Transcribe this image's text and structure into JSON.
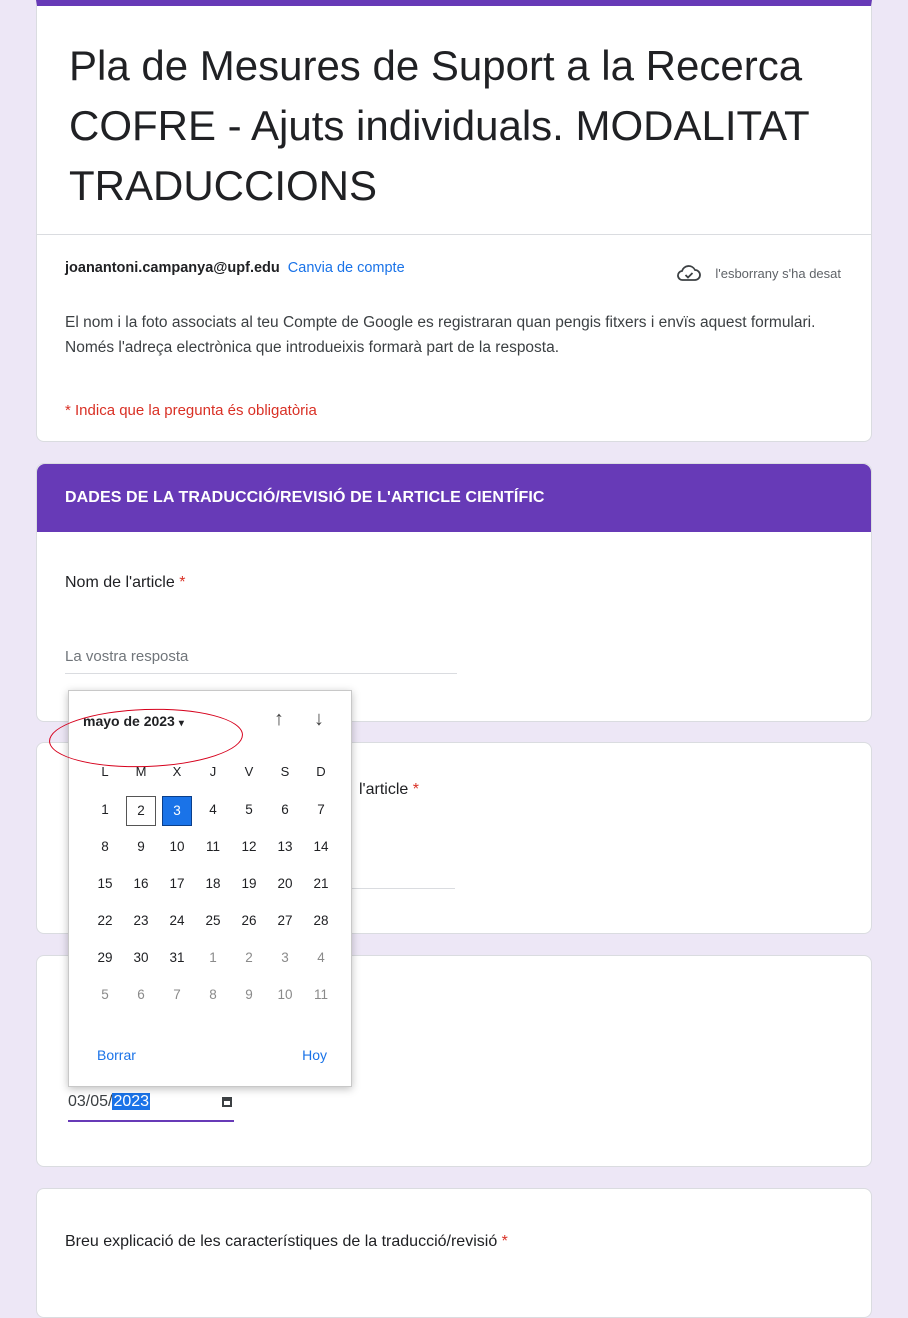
{
  "form": {
    "title": "Pla de Mesures de Suport a la Recerca  COFRE - Ajuts individuals. MODALITAT TRADUCCIONS",
    "account_email": "joanantoni.campanya@upf.edu",
    "switch_account": "Canvia de compte",
    "draft_saved": "l'esborrany s'ha desat",
    "notice": "El nom i la foto associats al teu Compte de Google es registraran quan pengis fitxers i envïs aquest formulari. Només l'adreça electrònica que introdueixis formarà part de la resposta.",
    "required_notice": "* Indica que la pregunta és obligatòria"
  },
  "section": {
    "header": "DADES DE LA TRADUCCIÓ/REVISIÓ DE L'ARTICLE CIENTÍFIC"
  },
  "questions": {
    "q1_label": "Nom de l'article ",
    "q1_asterisk": "*",
    "answer_placeholder": "La vostra resposta",
    "q2_label": "l'article ",
    "q2_asterisk": "*",
    "q4_label": "Breu explicació de les característiques de  la traducció/revisió ",
    "q4_asterisk": "*"
  },
  "date_field": {
    "day_month": "03/05/",
    "year": "2023"
  },
  "picker": {
    "month_label": "mayo de 2023",
    "caret": "▾",
    "up_arrow": "↑",
    "down_arrow": "↓",
    "weekdays": [
      "L",
      "M",
      "X",
      "J",
      "V",
      "S",
      "D"
    ],
    "days": [
      "1",
      "2",
      "3",
      "4",
      "5",
      "6",
      "7",
      "8",
      "9",
      "10",
      "11",
      "12",
      "13",
      "14",
      "15",
      "16",
      "17",
      "18",
      "19",
      "20",
      "21",
      "22",
      "23",
      "24",
      "25",
      "26",
      "27",
      "28",
      "29",
      "30",
      "31",
      "1",
      "2",
      "3",
      "4",
      "5",
      "6",
      "7",
      "8",
      "9",
      "10",
      "11"
    ],
    "today_day": "2",
    "selected_day": "3",
    "clear_label": "Borrar",
    "today_label": "Hoy"
  }
}
